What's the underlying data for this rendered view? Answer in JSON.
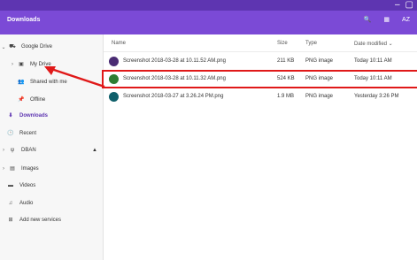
{
  "window": {
    "title": "Downloads",
    "buttons": [
      "–",
      "▢"
    ]
  },
  "header": {
    "icons": [
      {
        "name": "search-icon",
        "glyph": "🔍"
      },
      {
        "name": "grid-view-icon",
        "glyph": "▦"
      },
      {
        "name": "sort-icon",
        "glyph": "AZ"
      }
    ]
  },
  "sidebar": {
    "items": [
      {
        "label": "Google Drive",
        "icon": "⛟",
        "chev": "⌄",
        "name": "sidebar-item-google-drive"
      },
      {
        "label": "My Drive",
        "icon": "▣",
        "chev": "›",
        "name": "sidebar-item-my-drive"
      },
      {
        "label": "Shared with me",
        "icon": "👥",
        "chev": "",
        "name": "sidebar-item-shared-with-me"
      },
      {
        "label": "Offline",
        "icon": "📌",
        "chev": "",
        "name": "sidebar-item-offline"
      },
      {
        "label": "Downloads",
        "icon": "⬇",
        "chev": "",
        "name": "sidebar-item-downloads"
      },
      {
        "label": "Recent",
        "icon": "🕒",
        "chev": "",
        "name": "sidebar-item-recent"
      },
      {
        "label": "DBAN",
        "icon": "ψ",
        "chev": "›",
        "eject": "▲",
        "name": "sidebar-item-dban"
      },
      {
        "label": "Images",
        "icon": "▤",
        "chev": "›",
        "name": "sidebar-item-images"
      },
      {
        "label": "Videos",
        "icon": "▬",
        "chev": "",
        "name": "sidebar-item-videos"
      },
      {
        "label": "Audio",
        "icon": "♫",
        "chev": "",
        "name": "sidebar-item-audio"
      },
      {
        "label": "Add new services",
        "icon": "⊞",
        "chev": "",
        "name": "sidebar-item-add-new-services"
      }
    ]
  },
  "columns": {
    "name": "Name",
    "size": "Size",
    "type": "Type",
    "date": "Date modified ⌄"
  },
  "files": [
    {
      "name": "Screenshot 2018-03-28 at 10.11.52 AM.png",
      "size": "211 KB",
      "type": "PNG image",
      "date": "Today 10:11 AM"
    },
    {
      "name": "Screenshot 2018-03-28 at 10.11.32 AM.png",
      "size": "524 KB",
      "type": "PNG image",
      "date": "Today 10:11 AM"
    },
    {
      "name": "Screenshot 2018-03-27 at 3.26.24 PM.png",
      "size": "1.9 MB",
      "type": "PNG image",
      "date": "Yesterday 3:26 PM"
    }
  ],
  "colors": {
    "accent": "#7b4ad6",
    "highlight": "#e01919"
  }
}
